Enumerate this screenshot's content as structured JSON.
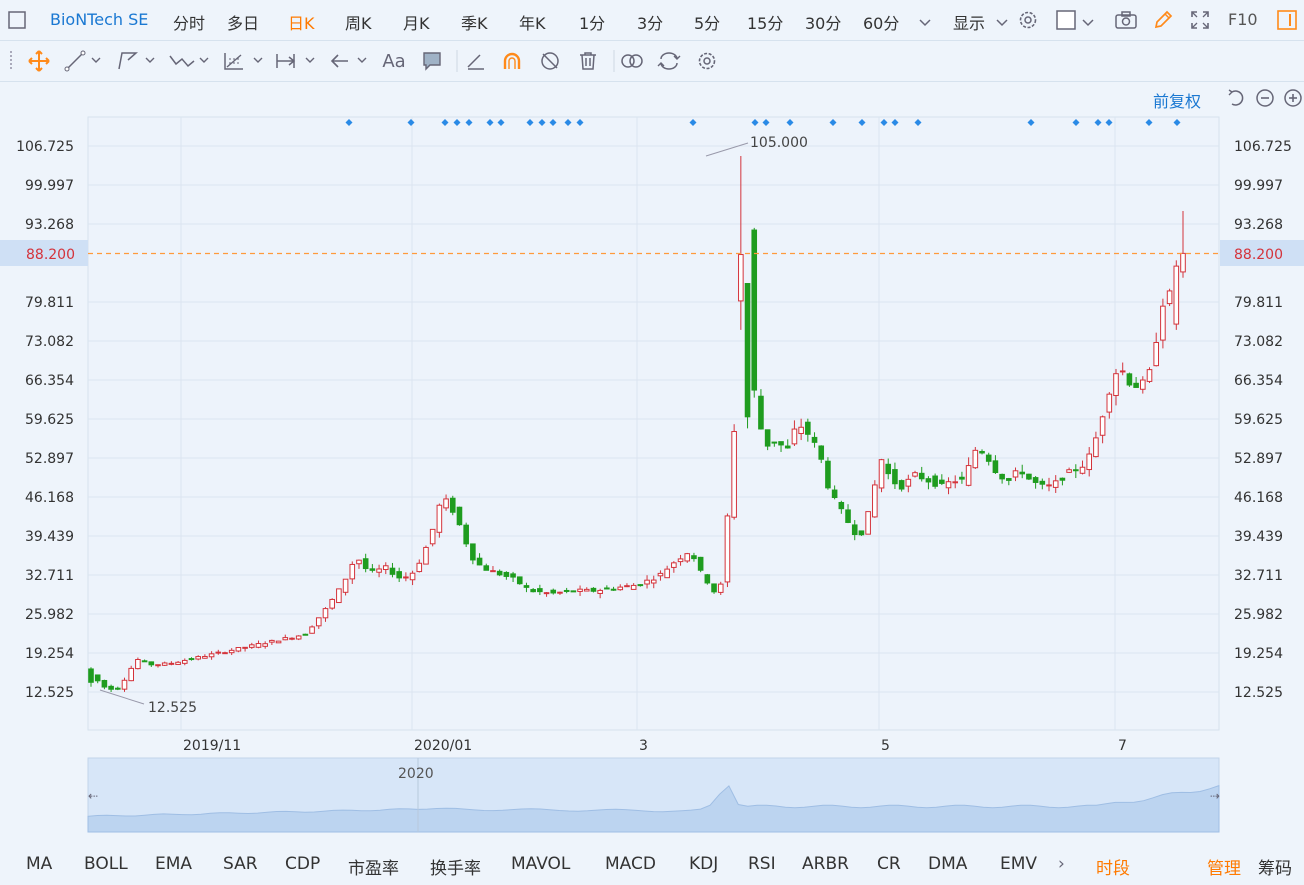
{
  "top": {
    "title": "BioNTech SE",
    "tabs": [
      "分时",
      "多日",
      "日K",
      "周K",
      "月K",
      "季K",
      "年K",
      "1分",
      "3分",
      "5分",
      "15分",
      "30分",
      "60分"
    ],
    "active_tab": "日K",
    "display": "显示",
    "f10": "F10"
  },
  "adjust": "前复权",
  "chart_data": {
    "type": "candlestick",
    "y_ticks": [
      "106.725",
      "99.997",
      "93.268",
      "88.200",
      "79.811",
      "73.082",
      "66.354",
      "59.625",
      "52.897",
      "46.168",
      "39.439",
      "32.711",
      "25.982",
      "19.254",
      "12.525"
    ],
    "y_range": [
      12.525,
      106.725
    ],
    "current_price": "88.200",
    "x_ticks": [
      "2019/11",
      "2020/01",
      "3",
      "5",
      "7"
    ],
    "annotations": {
      "max": "105.000",
      "min": "12.525"
    },
    "navigator_label": "2020"
  },
  "indicators": [
    "MA",
    "BOLL",
    "EMA",
    "SAR",
    "CDP",
    "市盈率",
    "换手率",
    "MAVOL",
    "MACD",
    "KDJ",
    "RSI",
    "ARBR",
    "CR",
    "DMA",
    "EMV"
  ],
  "bottom_right": {
    "period": "时段",
    "manage": "管理",
    "chips": "筹码"
  },
  "colors": {
    "up": "#d4333b",
    "down": "#1f9c1f",
    "accent": "#1a78d2",
    "active": "#ff7a00",
    "price_line": "#ff9a3c"
  }
}
